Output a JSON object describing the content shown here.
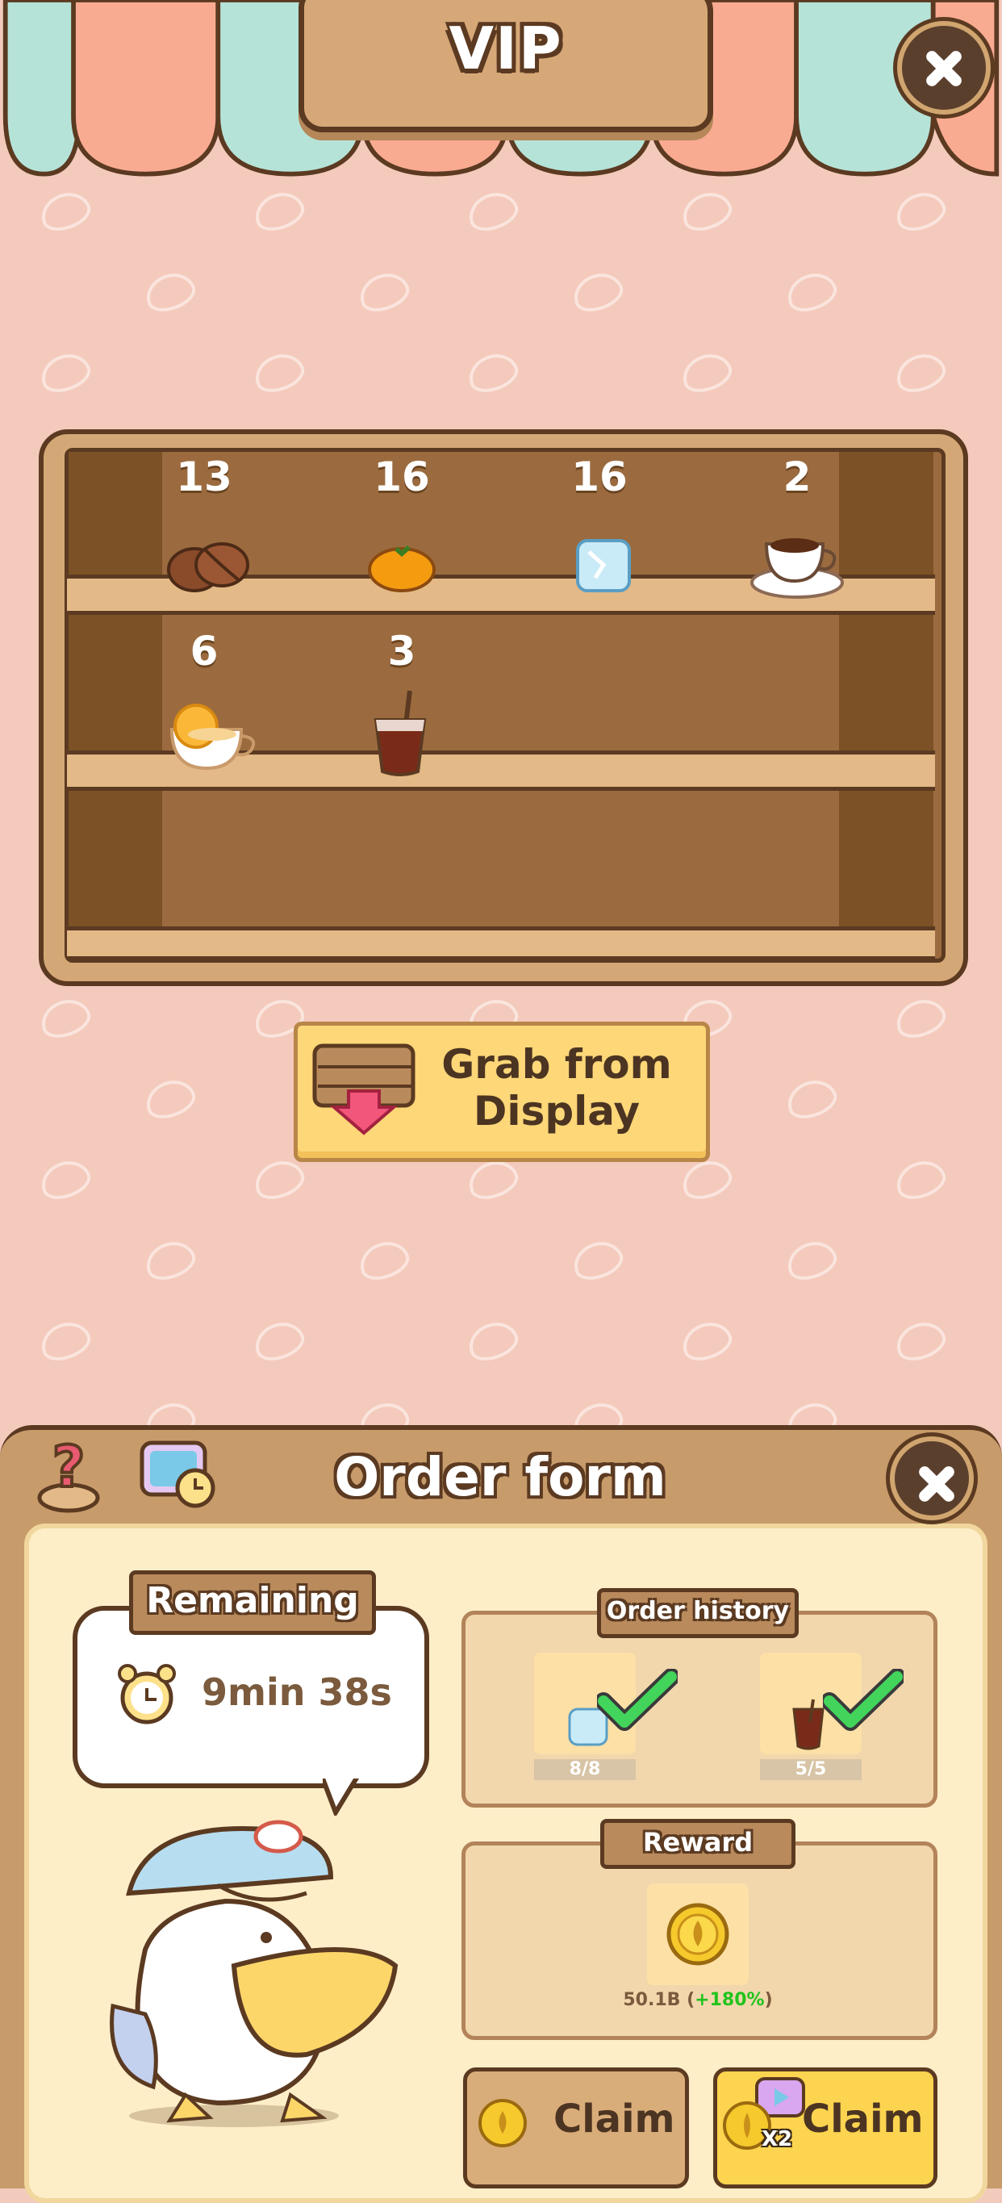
{
  "header": {
    "title": "VIP"
  },
  "shelf": {
    "items": [
      {
        "name": "coffee-beans",
        "count": "13"
      },
      {
        "name": "orange",
        "count": "16"
      },
      {
        "name": "ice-cube",
        "count": "16"
      },
      {
        "name": "coffee-cup",
        "count": "2"
      },
      {
        "name": "orange-tea",
        "count": "6"
      },
      {
        "name": "iced-coffee",
        "count": "3"
      }
    ]
  },
  "grab_button": {
    "line1": "Grab from",
    "line2": "Display"
  },
  "order_form": {
    "title": "Order form",
    "remaining_label": "Remaining",
    "remaining_time": "9min 38s",
    "order_history_label": "Order history",
    "history": [
      {
        "item": "ice-cube",
        "progress": "8/8"
      },
      {
        "item": "iced-coffee",
        "progress": "5/5"
      }
    ],
    "reward_label": "Reward",
    "reward_amount": "50.1B",
    "reward_bonus": "+180%",
    "claim_label": "Claim",
    "claim_x2_label": "Claim",
    "x2_badge": "X2"
  },
  "colors": {
    "accent_yellow": "#fdd778",
    "wood": "#c89b6b",
    "dark_brown": "#5b3a21",
    "bonus_green": "#22c31d"
  }
}
